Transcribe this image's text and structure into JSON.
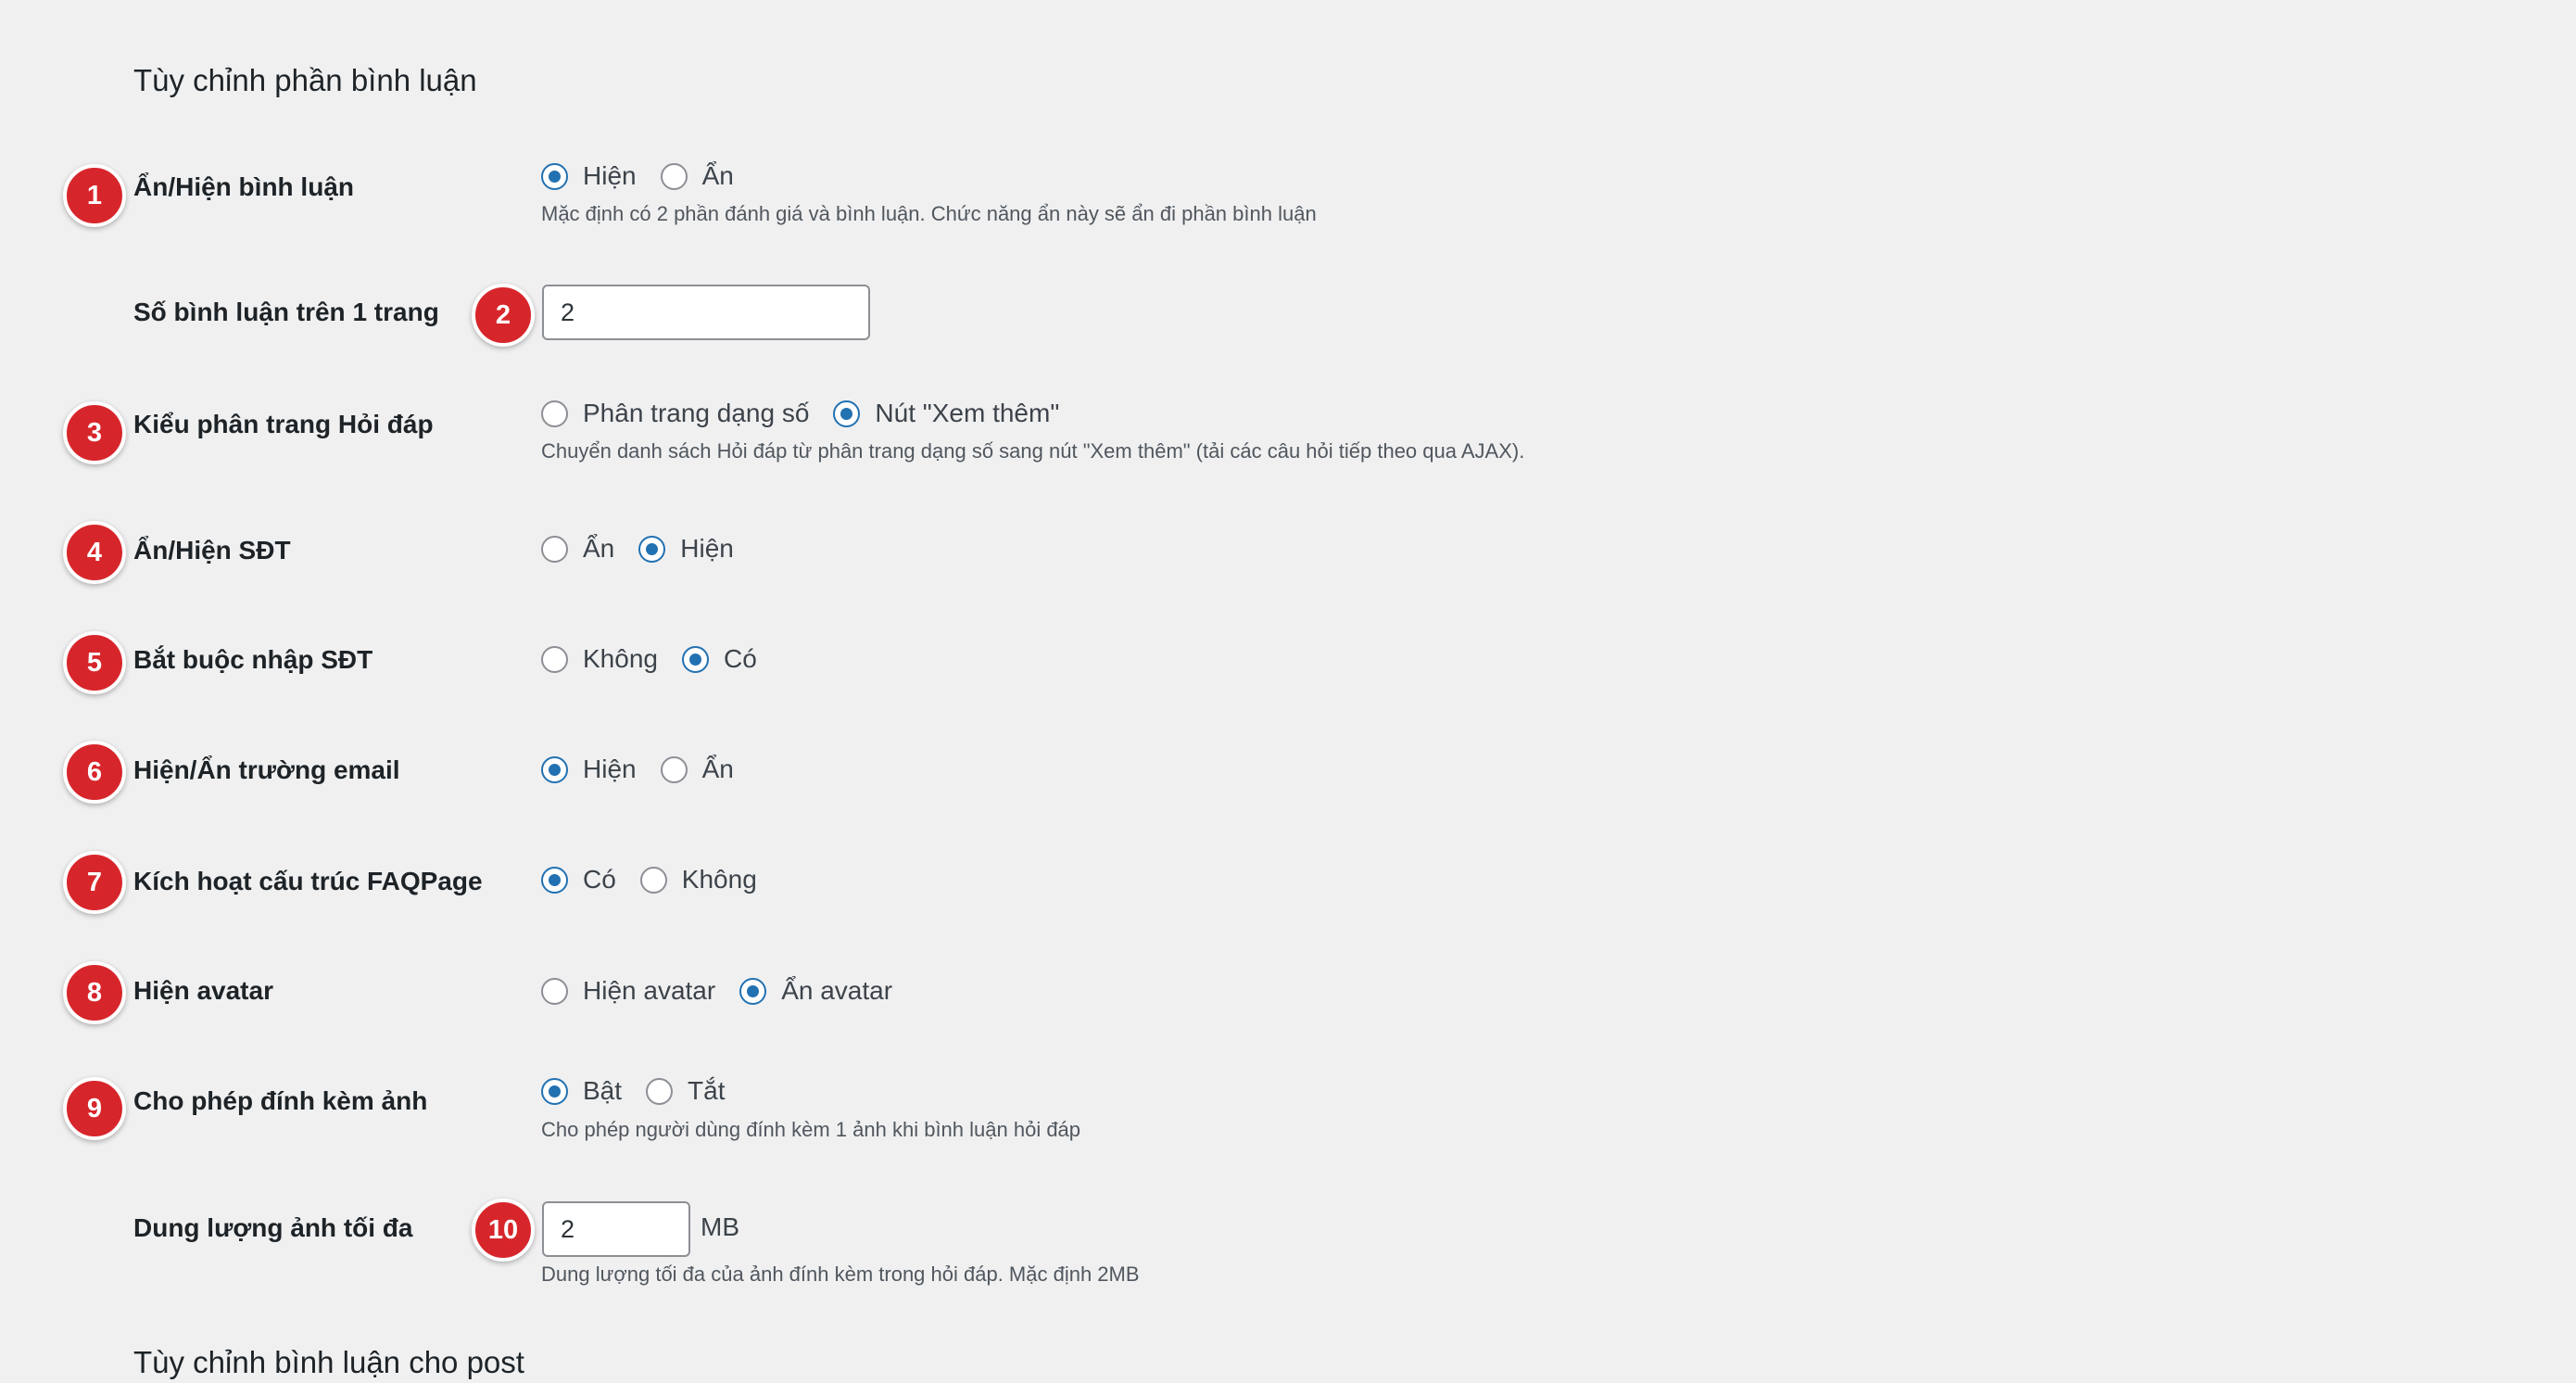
{
  "sections": {
    "comments_title": "Tùy chỉnh phần bình luận",
    "post_comments_title": "Tùy chỉnh bình luận cho post"
  },
  "badges": [
    "1",
    "2",
    "3",
    "4",
    "5",
    "6",
    "7",
    "8",
    "9",
    "10"
  ],
  "rows": {
    "show_comments": {
      "label": "Ẩn/Hiện bình luận",
      "options": [
        "Hiện",
        "Ẩn"
      ],
      "selected": "Hiện",
      "description": "Mặc định có 2 phần đánh giá và bình luận. Chức năng ẩn này sẽ ẩn đi phần bình luận"
    },
    "comments_per_page": {
      "label": "Số bình luận trên 1 trang",
      "value": "2"
    },
    "qa_pagination": {
      "label": "Kiểu phân trang Hỏi đáp",
      "options": [
        "Phân trang dạng số",
        "Nút \"Xem thêm\""
      ],
      "selected": "Nút \"Xem thêm\"",
      "description": "Chuyển danh sách Hỏi đáp từ phân trang dạng số sang nút \"Xem thêm\" (tải các câu hỏi tiếp theo qua AJAX)."
    },
    "show_phone": {
      "label": "Ẩn/Hiện SĐT",
      "options": [
        "Ẩn",
        "Hiện"
      ],
      "selected": "Hiện"
    },
    "require_phone": {
      "label": "Bắt buộc nhập SĐT",
      "options": [
        "Không",
        "Có"
      ],
      "selected": "Có"
    },
    "show_email": {
      "label": "Hiện/Ẩn trường email",
      "options": [
        "Hiện",
        "Ẩn"
      ],
      "selected": "Hiện"
    },
    "faqpage_schema": {
      "label": "Kích hoạt cấu trúc FAQPage",
      "options": [
        "Có",
        "Không"
      ],
      "selected": "Có"
    },
    "show_avatar": {
      "label": "Hiện avatar",
      "options": [
        "Hiện avatar",
        "Ẩn avatar"
      ],
      "selected": "Ẩn avatar"
    },
    "allow_image": {
      "label": "Cho phép đính kèm ảnh",
      "options": [
        "Bật",
        "Tắt"
      ],
      "selected": "Bật",
      "description": "Cho phép người dùng đính kèm 1 ảnh khi bình luận hỏi đáp"
    },
    "max_image_size": {
      "label": "Dung lượng ảnh tối đa",
      "value": "2",
      "unit": "MB",
      "description": "Dung lượng tối đa của ảnh đính kèm trong hỏi đáp. Mặc định 2MB"
    }
  },
  "colors": {
    "badge": "#d7262b",
    "radio_checked": "#2271b1",
    "background": "#f0f0f1"
  }
}
